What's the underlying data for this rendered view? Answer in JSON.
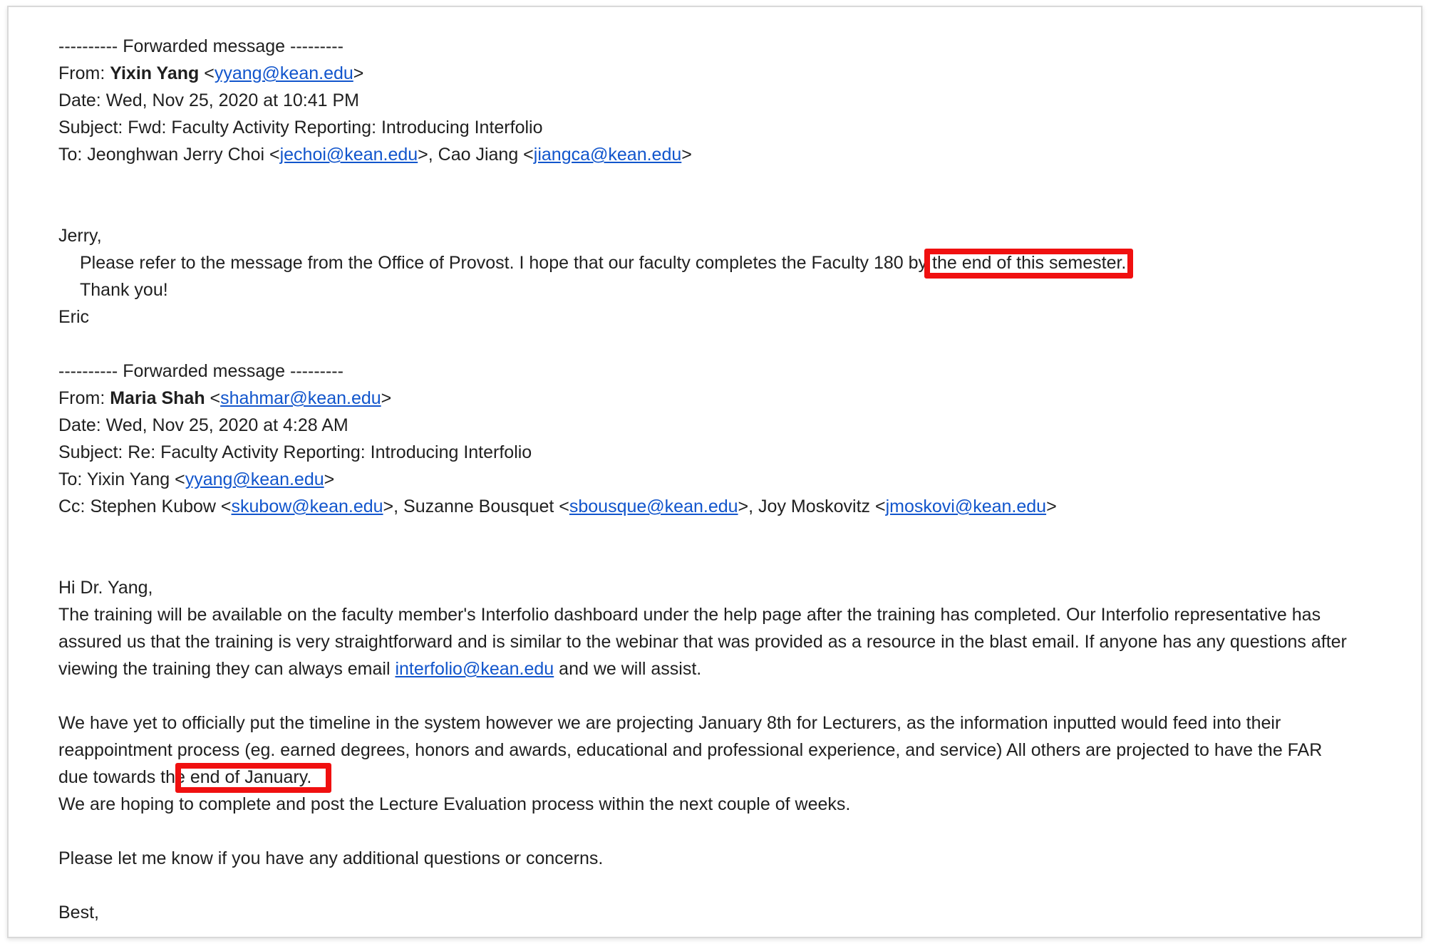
{
  "email": {
    "fwd1": {
      "divider": "---------- Forwarded message ---------",
      "from_label": "From: ",
      "from_name": "Yixin Yang",
      "from_email": "yyang@kean.edu",
      "date": "Date: Wed, Nov 25, 2020 at 10:41 PM",
      "subject": "Subject: Fwd: Faculty Activity Reporting: Introducing Interfolio",
      "to_label": "To: Jeonghwan Jerry Choi <",
      "to_email1": "jechoi@kean.edu",
      "to_mid": ">, Cao Jiang <",
      "to_email2": "jiangca@kean.edu",
      "to_end": ">"
    },
    "body1": {
      "greeting": "Jerry,",
      "line1_pre": "Please refer to the message from the Office of Provost. I hope that our faculty completes the Faculty 180 by",
      "line1_highlight": " the end of this semester.",
      "thanks": "Thank you!",
      "signature": "Eric"
    },
    "fwd2": {
      "divider": "---------- Forwarded message ---------",
      "from_label": "From: ",
      "from_name": "Maria Shah",
      "from_email": "shahmar@kean.edu",
      "date": "Date: Wed, Nov 25, 2020 at 4:28 AM",
      "subject": "Subject: Re: Faculty Activity Reporting: Introducing Interfolio",
      "to_label": "To: Yixin Yang <",
      "to_email": "yyang@kean.edu",
      "to_end": ">",
      "cc_label": "Cc: Stephen Kubow <",
      "cc_email1": "skubow@kean.edu",
      "cc_mid1": ">, Suzanne Bousquet <",
      "cc_email2": "sbousque@kean.edu",
      "cc_mid2": ">, Joy Moskovitz <",
      "cc_email3": "jmoskovi@kean.edu",
      "cc_end": ">"
    },
    "body2": {
      "greeting": "Hi Dr. Yang,",
      "p1_line1": "The training will be available on the faculty member's Interfolio dashboard under the help page after the training has completed. Our Interfolio representative has",
      "p1_line2": "assured us that the training is very straightforward and is similar to the webinar that was provided as a resource in the blast email. If anyone has any questions after",
      "p1_line3_pre": "viewing the training they can always email ",
      "p1_email": "interfolio@kean.edu",
      "p1_line3_post": " and we will assist.",
      "p2_line1": "We have yet to officially put the timeline in the system however we are projecting January 8th for Lecturers, as the information inputted would feed into their",
      "p2_line2": "reappointment process (eg. earned degrees, honors and awards, educational and professional experience, and service) All others are projected to have the FAR",
      "p2_line3_pre": "due towards the",
      "p2_line3_highlight": " end of January.",
      "p3": "We are hoping to complete and post the Lecture Evaluation process within the next couple of weeks.",
      "p4": "Please let me know if you have any additional questions or concerns.",
      "closing": "Best,"
    }
  },
  "colors": {
    "link": "#1155cc",
    "highlight_border": "#f01010",
    "text": "#1f1f1f"
  }
}
